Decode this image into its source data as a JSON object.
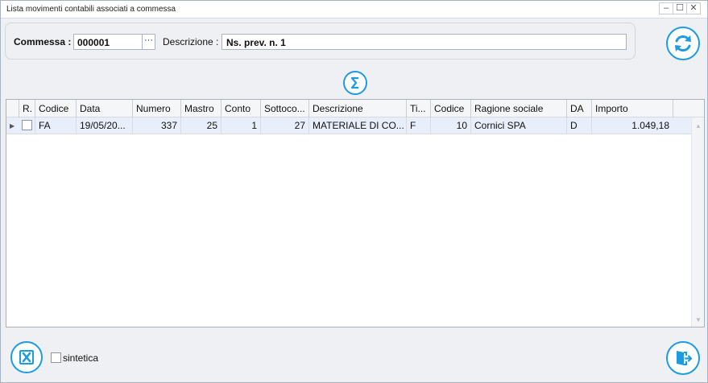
{
  "window": {
    "title": "Lista movimenti contabili associati a commessa",
    "controls": [
      "–",
      "☐",
      "✕"
    ]
  },
  "header": {
    "commessa_label": "Commessa :",
    "commessa_value": "000001",
    "ellipsis": "···",
    "descrizione_label": "Descrizione :",
    "descrizione_value": "Ns. prev. n. 1"
  },
  "icons": {
    "refresh": "refresh-icon",
    "sum": "sigma-icon",
    "excel": "excel-export-icon",
    "exit": "exit-icon",
    "accent": "#1e9be0"
  },
  "table": {
    "columns": [
      "R.",
      "Codice",
      "Data",
      "Numero",
      "Mastro",
      "Conto",
      "Sottoco...",
      "Descrizione",
      "Ti...",
      "Codice",
      "Ragione sociale",
      "DA",
      "Importo"
    ],
    "rows": [
      {
        "r": "",
        "codice": "FA",
        "data": "19/05/20...",
        "numero": "337",
        "mastro": "25",
        "conto": "1",
        "sottoconto": "27",
        "descrizione": "MATERIALE DI CO...",
        "tipo": "F",
        "codice2": "10",
        "ragione_sociale": "Cornici SPA",
        "da": "D",
        "importo": "1.049,18"
      }
    ]
  },
  "footer": {
    "sintetica_label": "sintetica",
    "sintetica_checked": false
  }
}
